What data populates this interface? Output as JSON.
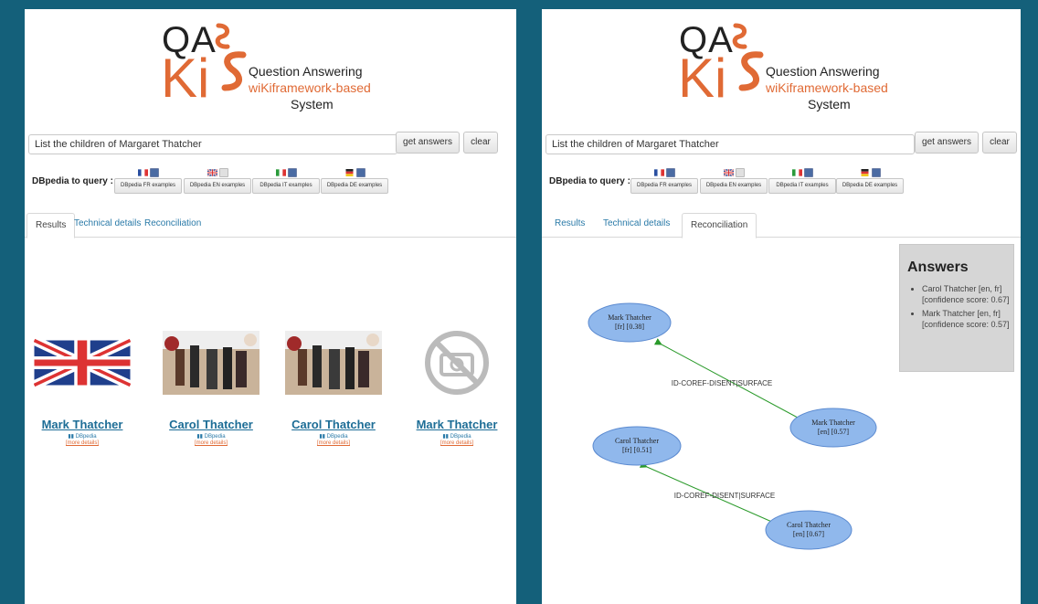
{
  "logo": {
    "qa": "QA",
    "ki": "Ki",
    "line1": "Question Answering",
    "line2": "wiKiframework-based",
    "line3": "System"
  },
  "search": {
    "value": "List the children of Margaret Thatcher"
  },
  "buttons": {
    "get_answers": "get answers",
    "clear": "clear"
  },
  "dbpedia_label": "DBpedia to query :",
  "languages": [
    {
      "code": "fr",
      "checked": true,
      "label": "DBpedia FR examples"
    },
    {
      "code": "en",
      "checked": false,
      "label": "DBpedia EN examples"
    },
    {
      "code": "it",
      "checked": true,
      "label": "DBpedia IT examples"
    },
    {
      "code": "de",
      "checked": true,
      "label": "DBpedia DE examples"
    }
  ],
  "tabs": [
    "Results",
    "Technical details",
    "Reconciliation"
  ],
  "left": {
    "active_tab": 0
  },
  "right": {
    "active_tab": 2
  },
  "results": [
    {
      "name": "Mark Thatcher",
      "source": "DBpedia",
      "flag": "fr",
      "more": "[more details]",
      "image": "uk-flag"
    },
    {
      "name": "Carol Thatcher",
      "source": "DBpedia",
      "flag": "fr",
      "more": "[more details]",
      "image": "photo"
    },
    {
      "name": "Carol Thatcher",
      "source": "DBpedia",
      "flag": "en",
      "more": "[more details]",
      "image": "photo"
    },
    {
      "name": "Mark Thatcher",
      "source": "DBpedia",
      "flag": "en",
      "more": "[more details]",
      "image": "no-image-camera-icon"
    }
  ],
  "answers": {
    "title": "Answers",
    "items": [
      "Carol Thatcher [en, fr] [confidence score: 0.67]",
      "Mark Thatcher [en, fr] [confidence score: 0.57]"
    ]
  },
  "graph": {
    "nodes": [
      {
        "line1": "Mark Thatcher",
        "line2": "[fr] [0.38]"
      },
      {
        "line1": "Mark Thatcher",
        "line2": "[en] [0.57]"
      },
      {
        "line1": "Carol Thatcher",
        "line2": "[fr] [0.51]"
      },
      {
        "line1": "Carol Thatcher",
        "line2": "[en] [0.67]"
      }
    ],
    "edges": [
      {
        "label": "ID-COREF-DISENT|SURFACE"
      },
      {
        "label": "ID-COREF-DISENT|SURFACE"
      }
    ]
  },
  "colors": {
    "frame": "#14607a",
    "brand_orange": "#e06a35",
    "link_blue": "#2a7aa8",
    "node_fill": "#90b8ec",
    "node_stroke": "#5b8ad0",
    "edge": "#2a9a2a"
  }
}
